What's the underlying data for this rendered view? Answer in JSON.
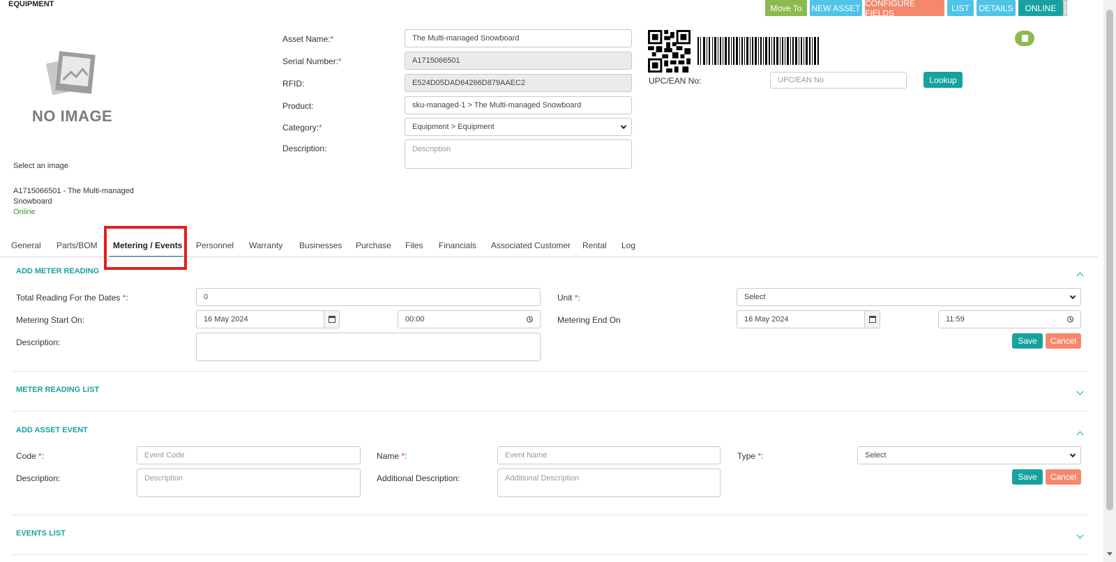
{
  "header": {
    "title": "EQUIPMENT",
    "buttons": {
      "move_to": "Move To",
      "new_asset": "NEW ASSET",
      "configure_fields": "CONFIGURE FIELDS",
      "list": "LIST",
      "details": "DETAILS",
      "online": "ONLINE"
    }
  },
  "image_panel": {
    "no_image_text": "NO IMAGE",
    "select_image": "Select an image",
    "asset_caption_line1": "A1715066501 - The Multi-managed",
    "asset_caption_line2": "Snowboard",
    "status": "Online"
  },
  "form": {
    "asset_name_label": "Asset Name:",
    "asset_name_value": "The Multi-managed Snowboard",
    "serial_label": "Serial Number:",
    "serial_value": "A1715066501",
    "rfid_label": "RFID:",
    "rfid_value": "E524D05DAD64266D879AAEC2",
    "product_label": "Product:",
    "product_value": "sku-managed-1 > The Multi-managed Snowboard",
    "category_label": "Category:",
    "category_value": "Equipment > Equipment",
    "description_label": "Description:",
    "description_placeholder": "Description",
    "upc_label": "UPC/EAN No:",
    "upc_placeholder": "UPC/EAN No",
    "lookup": "Lookup"
  },
  "tabs": [
    "General",
    "Parts/BOM",
    "Metering / Events",
    "Personnel",
    "Warranty",
    "Businesses",
    "Purchase",
    "Files",
    "Financials",
    "Associated Customer",
    "Rental",
    "Log"
  ],
  "meter": {
    "section_title": "ADD METER READING",
    "total_label": "Total Reading For the Dates",
    "total_value": "0",
    "unit_label": "Unit",
    "unit_value": "Select",
    "start_label": "Metering Start On:",
    "start_date": "16 May 2024",
    "start_time": "00:00",
    "end_label": "Metering End On",
    "end_date": "16 May 2024",
    "end_time": "11:59",
    "description_label": "Description:",
    "save": "Save",
    "cancel": "Cancel"
  },
  "meter_list": {
    "section_title": "METER READING LIST"
  },
  "event": {
    "section_title": "ADD ASSET EVENT",
    "code_label": "Code",
    "code_placeholder": "Event Code",
    "name_label": "Name",
    "name_placeholder": "Event Name",
    "type_label": "Type",
    "type_value": "Select",
    "description_label": "Description:",
    "description_placeholder": "Description",
    "additional_label": "Additional Description:",
    "additional_placeholder": "Additional Description",
    "save": "Save",
    "cancel": "Cancel"
  },
  "events_list": {
    "section_title": "EVENTS LIST"
  },
  "colors": {
    "teal": "#17a2a0",
    "green": "#8bba4f",
    "sky": "#4fc3e8",
    "salmon": "#f5886b",
    "highlight_red": "#e31e1e"
  }
}
